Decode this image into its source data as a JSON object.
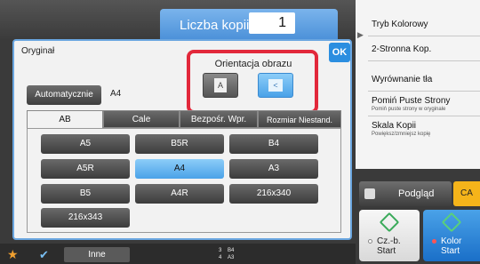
{
  "header": {
    "copies_label": "Liczba kopii",
    "copies_value": "1"
  },
  "dialog": {
    "title": "Oryginał",
    "ok_label": "OK",
    "orientation_label": "Orientacja obrazu",
    "orientation_a_glyph": "A",
    "orientation_b_glyph": "<",
    "auto_label": "Automatycznie",
    "auto_value": "A4",
    "tabs": [
      "AB",
      "Cale",
      "Bezpośr. Wpr.",
      "Rozmiar Niestand."
    ],
    "sizes": [
      "A5",
      "B5R",
      "B4",
      "A5R",
      "A4",
      "A3",
      "B5",
      "A4R",
      "216x340",
      "216x343"
    ],
    "selected_size": "A4"
  },
  "bottom": {
    "inne_label": "Inne",
    "trays": [
      [
        "3",
        "B4"
      ],
      [
        "4",
        "A3"
      ]
    ]
  },
  "right": {
    "items": [
      {
        "label": "Tryb Kolorowy",
        "sub": ""
      },
      {
        "label": "2-Stronna Kop.",
        "sub": ""
      },
      {
        "label": "Wyrównanie tła",
        "sub": ""
      },
      {
        "label": "Pomiń Puste Strony",
        "sub": "Pomiń puste strony w oryginale"
      },
      {
        "label": "Skala Kopii",
        "sub": "Powiększ/zmniejsz kopię"
      }
    ],
    "preview_label": "Podgląd",
    "ca_label": "CA",
    "start_bw": [
      "Cz.-b.",
      "Start"
    ],
    "start_color": [
      "Kolor",
      "Start"
    ]
  },
  "colors": {
    "accent": "#4aa2e8",
    "highlight": "#e2283b",
    "ca": "#f5b41a"
  }
}
